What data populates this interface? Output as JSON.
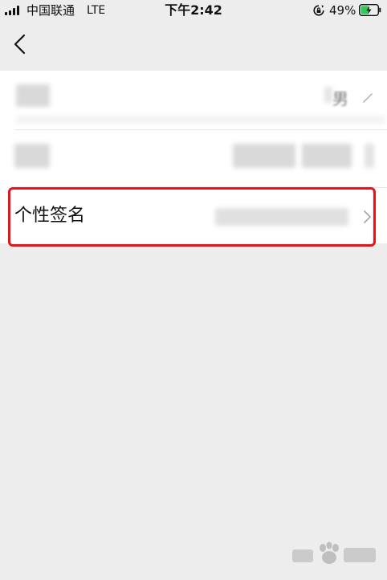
{
  "status_bar": {
    "carrier": "中国联通",
    "network": "LTE",
    "time": "下午2:42",
    "battery_percent": "49%",
    "battery_level": 0.49,
    "icons": [
      "signal-icon",
      "rotation-lock-icon",
      "battery-icon"
    ]
  },
  "nav": {
    "back_icon": "chevron-left-icon"
  },
  "rows": [
    {
      "label": "",
      "value_partial": "男",
      "trailing_icon": "edit-icon"
    },
    {
      "label": "",
      "value": "",
      "trailing_icon": ""
    },
    {
      "label": "个性签名",
      "value": "",
      "trailing_icon": "chevron-right-icon"
    }
  ],
  "colors": {
    "background": "#ededed",
    "surface": "#ffffff",
    "highlight": "#e8131a",
    "battery_fill": "#34c759"
  },
  "watermark": {
    "logo": "baidu-jingyan-logo"
  }
}
